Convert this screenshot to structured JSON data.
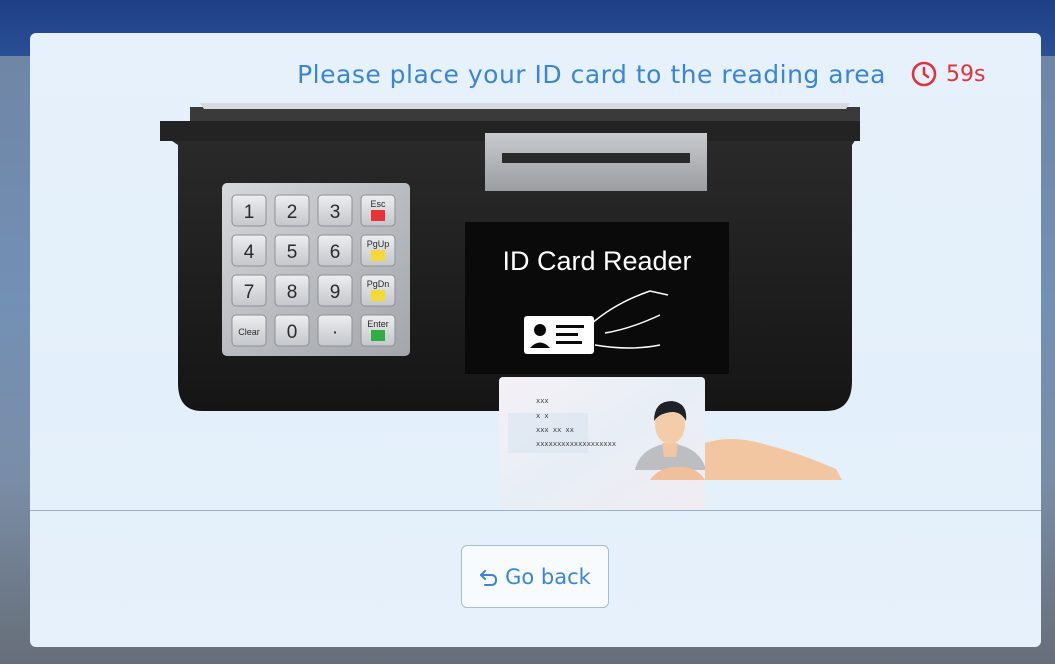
{
  "prompt": {
    "instruction": "Please place your ID card to the reading area",
    "timer": "59s"
  },
  "illustration": {
    "screen_title": "ID Card Reader",
    "keypad_keys": [
      "1",
      "2",
      "3",
      "Esc",
      "4",
      "5",
      "6",
      "PgUp",
      "7",
      "8",
      "9",
      "PgDn",
      "Clear",
      "0",
      "·",
      "Enter"
    ],
    "card_lines": [
      "xxx",
      "x          x",
      "xxx    xx      xx",
      "xxxxxxxxxxxxxxxxxxx"
    ]
  },
  "actions": {
    "back_label": "Go back"
  },
  "colors": {
    "accent": "#3a85d6",
    "timer": "#e0333f",
    "header": "#1f3f86"
  }
}
